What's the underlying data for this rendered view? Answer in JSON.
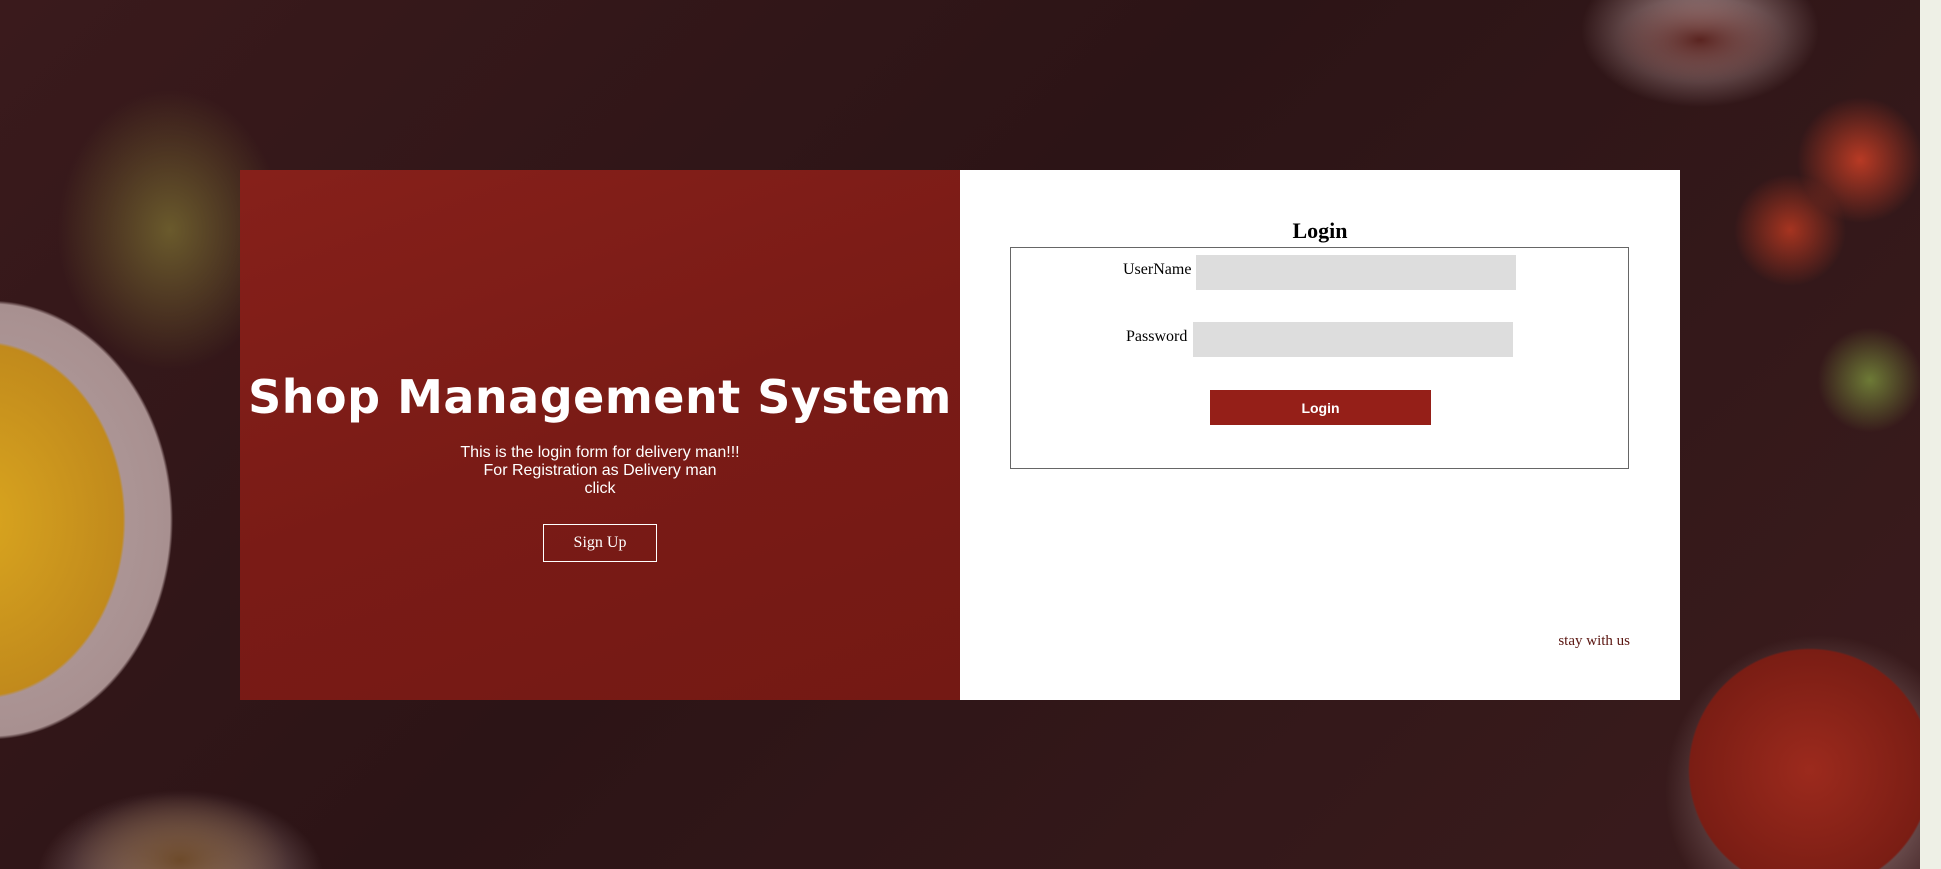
{
  "brand": {
    "title": "Shop Management System",
    "description_lines": [
      "This is the login form for delivery man!!!",
      "For Registration as Delivery man",
      "click"
    ],
    "signup_label": "Sign Up"
  },
  "login": {
    "heading": "Login",
    "username_label": "UserName",
    "username_value": "",
    "password_label": "Password",
    "password_value": "",
    "submit_label": "Login"
  },
  "footer": {
    "note": "stay with us"
  },
  "colors": {
    "accent": "#951f18",
    "panel": "#7c1c17",
    "input_bg": "#dddddd"
  }
}
